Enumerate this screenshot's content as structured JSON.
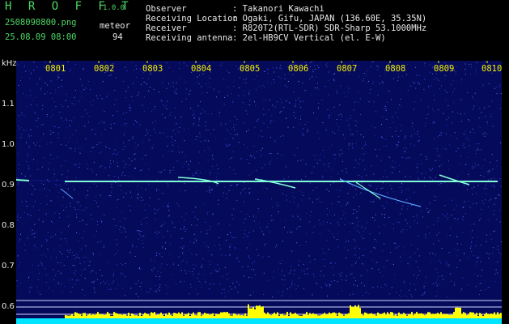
{
  "header": {
    "app_name": "H R O F F T",
    "version": "1.0.0",
    "filename": "2508090800.png",
    "datetime": "25.08.09 08:00",
    "meteor_label": "meteor",
    "meteor_count": "94",
    "fields": [
      {
        "label": "Observer",
        "value": ": Takanori Kawachi"
      },
      {
        "label": "Receiving Location",
        "value": ": Ogaki, Gifu, JAPAN (136.60E, 35.35N)"
      },
      {
        "label": "Receiver",
        "value": ": R820T2(RTL-SDR) SDR-Sharp 53.1000MHz"
      },
      {
        "label": "Receiving antenna",
        "value": ": 2el-HB9CV Vertical (el. E-W)"
      }
    ]
  },
  "axis": {
    "unit": "kHz",
    "y_ticks": [
      "1.1",
      "1.0",
      "0.9",
      "0.8",
      "0.7",
      "0.6"
    ],
    "time_ticks": [
      "0801",
      "0802",
      "0803",
      "0804",
      "0805",
      "0806",
      "0807",
      "0808",
      "0809",
      "0810"
    ]
  },
  "colors": {
    "background": "#000000",
    "plot_bg": "#060a5a",
    "carrier": "#7fffd4",
    "level_bar": "#ffff00",
    "level_base": "#00e5ff",
    "text_green": "#4cd964"
  }
}
